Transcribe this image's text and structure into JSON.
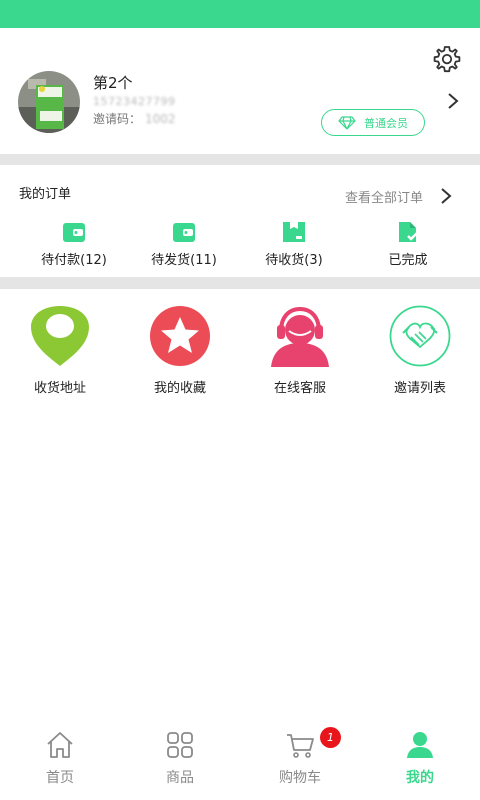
{
  "colors": {
    "accent": "#3ad88e",
    "divider": "#e5e5e5",
    "badge": "#e8151b"
  },
  "profile": {
    "name": "第2个",
    "phone": "15723427799",
    "invite_label": "邀请码：",
    "invite_code": "1002",
    "member_level": "普通会员"
  },
  "orders": {
    "title": "我的订单",
    "view_all": "查看全部订单",
    "items": [
      {
        "label": "待付款(12)",
        "icon": "wallet-icon"
      },
      {
        "label": "待发货(11)",
        "icon": "wallet-icon"
      },
      {
        "label": "待收货(3)",
        "icon": "package-icon"
      },
      {
        "label": "已完成",
        "icon": "document-check-icon"
      }
    ]
  },
  "services": [
    {
      "label": "收货地址",
      "icon": "location-pin-icon"
    },
    {
      "label": "我的收藏",
      "icon": "star-icon"
    },
    {
      "label": "在线客服",
      "icon": "customer-service-icon"
    },
    {
      "label": "邀请列表",
      "icon": "handshake-icon"
    }
  ],
  "tabbar": {
    "tabs": [
      {
        "label": "首页",
        "icon": "home-icon"
      },
      {
        "label": "商品",
        "icon": "grid-icon"
      },
      {
        "label": "购物车",
        "icon": "cart-icon"
      },
      {
        "label": "我的",
        "icon": "user-icon"
      }
    ],
    "cart_badge": "1",
    "active": "我的"
  }
}
